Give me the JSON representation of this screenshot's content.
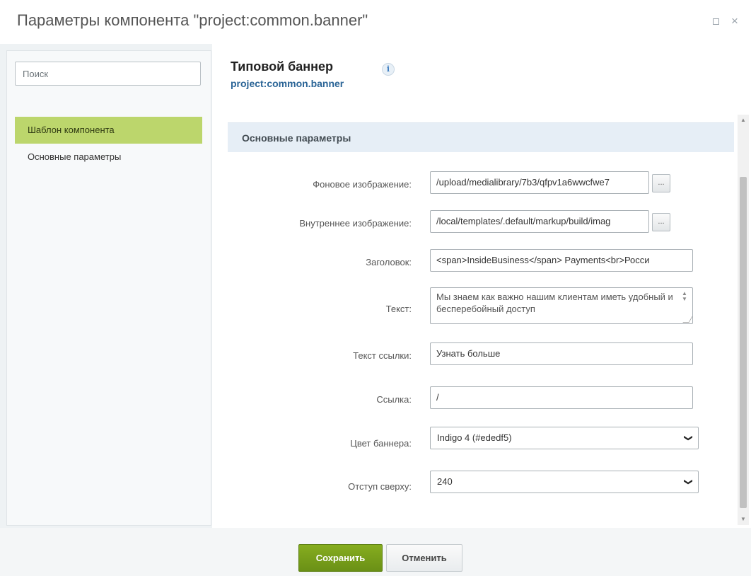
{
  "dialog": {
    "title": "Параметры компонента \"project:common.banner\"",
    "maximize_icon": "square-icon",
    "close_icon": "×"
  },
  "sidebar": {
    "search_placeholder": "Поиск",
    "items": [
      {
        "label": "Шаблон компонента",
        "active": true
      },
      {
        "label": "Основные параметры",
        "active": false
      }
    ]
  },
  "component": {
    "name": "Типовой баннер",
    "id": "project:common.banner",
    "info_icon": "i"
  },
  "section": {
    "title": "Основные параметры"
  },
  "fields": {
    "background_image": {
      "label": "Фоновое изображение:",
      "value": "/upload/medialibrary/7b3/qfpv1a6wwcfwe7",
      "button": "..."
    },
    "inner_image": {
      "label": "Внутреннее изображение:",
      "value": "/local/templates/.default/markup/build/imag",
      "button": "..."
    },
    "heading": {
      "label": "Заголовок:",
      "value": "<span>InsideBusiness</span> Payments<br>Росси"
    },
    "text": {
      "label": "Текст:",
      "value": "Мы знаем как важно нашим клиентам иметь удобный и бесперебойный доступ"
    },
    "link_text": {
      "label": "Текст ссылки:",
      "value": "Узнать больше"
    },
    "link": {
      "label": "Ссылка:",
      "value": "/"
    },
    "banner_color": {
      "label": "Цвет баннера:",
      "value": "Indigo 4 (#ededf5)"
    },
    "top_offset": {
      "label": "Отступ сверху:",
      "value": "240"
    }
  },
  "footer": {
    "save_label": "Сохранить",
    "cancel_label": "Отменить"
  },
  "colors": {
    "accent_green": "#7aa01b",
    "sidebar_active": "#bcd66c",
    "section_header_bg": "#e6eef6",
    "link_blue": "#2a6496"
  }
}
